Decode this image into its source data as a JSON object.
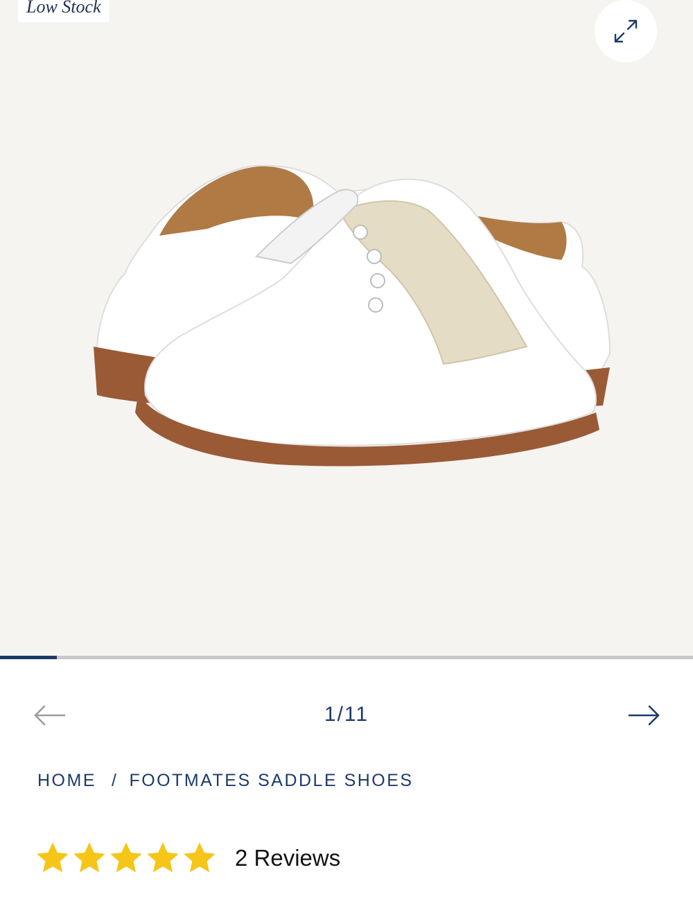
{
  "gallery": {
    "badge_text": "Low Stock",
    "expand_label": "expand",
    "image_alt": "White and beige saddle shoes",
    "progress_fraction": 0.0818
  },
  "pager": {
    "counter": "1/11",
    "current": 1,
    "total": 11
  },
  "breadcrumb": {
    "home": "HOME",
    "separator": "/",
    "current": "FOOTMATES SADDLE SHOES"
  },
  "rating": {
    "stars": 5,
    "max_stars": 5,
    "reviews_label": "2 Reviews"
  },
  "colors": {
    "accent": "#1d3a6b",
    "star": "#f5c518",
    "gallery_bg": "#f5f4f1"
  },
  "icons": {
    "expand": "expand-arrows-icon",
    "prev": "arrow-left-icon",
    "next": "arrow-right-icon",
    "star": "star-icon"
  }
}
